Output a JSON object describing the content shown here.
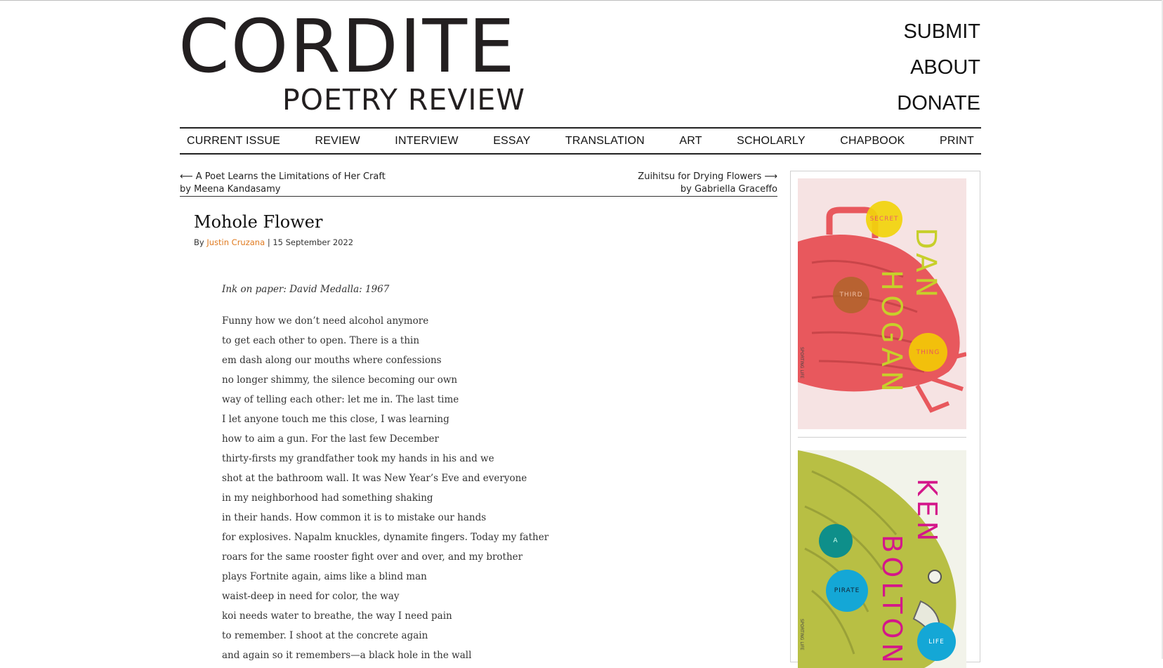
{
  "header": {
    "logo_main": "CORDITE",
    "logo_sub": "POETRY REVIEW",
    "top_links": [
      "SUBMIT",
      "ABOUT",
      "DONATE"
    ]
  },
  "nav": {
    "items": [
      "CURRENT ISSUE",
      "REVIEW",
      "INTERVIEW",
      "ESSAY",
      "TRANSLATION",
      "ART",
      "SCHOLARLY",
      "CHAPBOOK",
      "PRINT"
    ]
  },
  "post_nav": {
    "prev_title": "⟵ A Poet Learns the Limitations of Her Craft",
    "prev_author": "by Meena Kandasamy",
    "next_title": "Zuihitsu for Drying Flowers ⟶",
    "next_author": "by Gabriella Graceffo"
  },
  "article": {
    "title": "Mohole Flower",
    "by_label": "By",
    "author": "Justin Cruzana",
    "separator": "|",
    "date": "15 September 2022",
    "epigraph": "Ink on paper: David Medalla: 1967",
    "lines": [
      "Funny how we don’t need alcohol anymore",
      "to get each other to open. There is a thin",
      "em dash along our mouths where confessions",
      "no longer shimmy, the silence becoming our own",
      "way of telling each other: let me in. The last time",
      "I let anyone touch me this close, I was learning",
      "how to aim a gun. For the last few December",
      "thirty-firsts my grandfather took my hands in his and we",
      "shot at the bathroom wall. It was New Year’s Eve and everyone",
      "in my neighborhood had something shaking",
      "in their hands. How common it is to mistake our hands",
      "for explosives. Napalm knuckles, dynamite fingers. Today my father",
      "roars for the same rooster fight over and over, and my brother",
      "plays Fortnite again, aims like a blind man",
      "waist-deep in need for color, the way",
      "koi needs water to breathe, the way I need pain",
      "to remember. I shoot at the concrete again",
      "and again so it remembers—a black hole in the wall"
    ]
  },
  "sidebar": {
    "book1": {
      "author_first": "DAN",
      "author_last": "HOGAN",
      "words": [
        "SECRET",
        "THIRD",
        "THING"
      ],
      "spine_text": "SPORTING LIFE",
      "colors": {
        "bg": "#f6e3e3",
        "beetle": "#e8585d",
        "yellow": "#f2d40c",
        "orange": "#f28b1c",
        "brown": "#b0642a",
        "text": "#c7cf2a"
      }
    },
    "book2": {
      "author_first": "KEN",
      "author_last": "BOLTON",
      "words": [
        "A",
        "PIRATE",
        "LIFE"
      ],
      "spine_text": "SPORTING LIFE",
      "colors": {
        "bg": "#f2f3ea",
        "bird": "#b8bf44",
        "teal": "#0e8f8a",
        "cyan": "#14a7d6",
        "text": "#d4168a"
      }
    }
  }
}
